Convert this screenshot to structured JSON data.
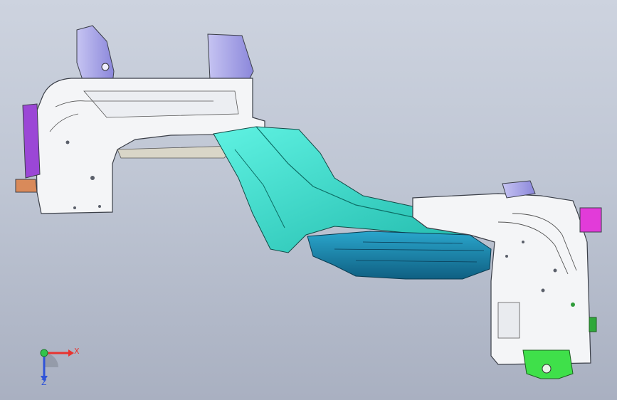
{
  "viewport": {
    "background_top": "#cdd3df",
    "background_bottom": "#a9b0c1"
  },
  "model": {
    "part_colors": {
      "sheet_metal": "#f4f5f7",
      "edges": "#3b3f48",
      "rail_cyan": "#33e0cf",
      "rail_cyan_dark": "#1fb8aa",
      "underbody_blue": "#1c8fb4",
      "underbody_dark": "#0f5f82",
      "bracket_purple": "#9b47d6",
      "bracket_magenta": "#e23bd9",
      "bracket_lavender": "#a9a6e8",
      "bracket_green": "#3fe04a",
      "bracket_orange": "#d98a5a"
    }
  },
  "triad": {
    "x_label": "X",
    "z_label": "Z",
    "x_color": "#e8332f",
    "z_color": "#2f53d8",
    "origin_color": "#31c44a"
  }
}
